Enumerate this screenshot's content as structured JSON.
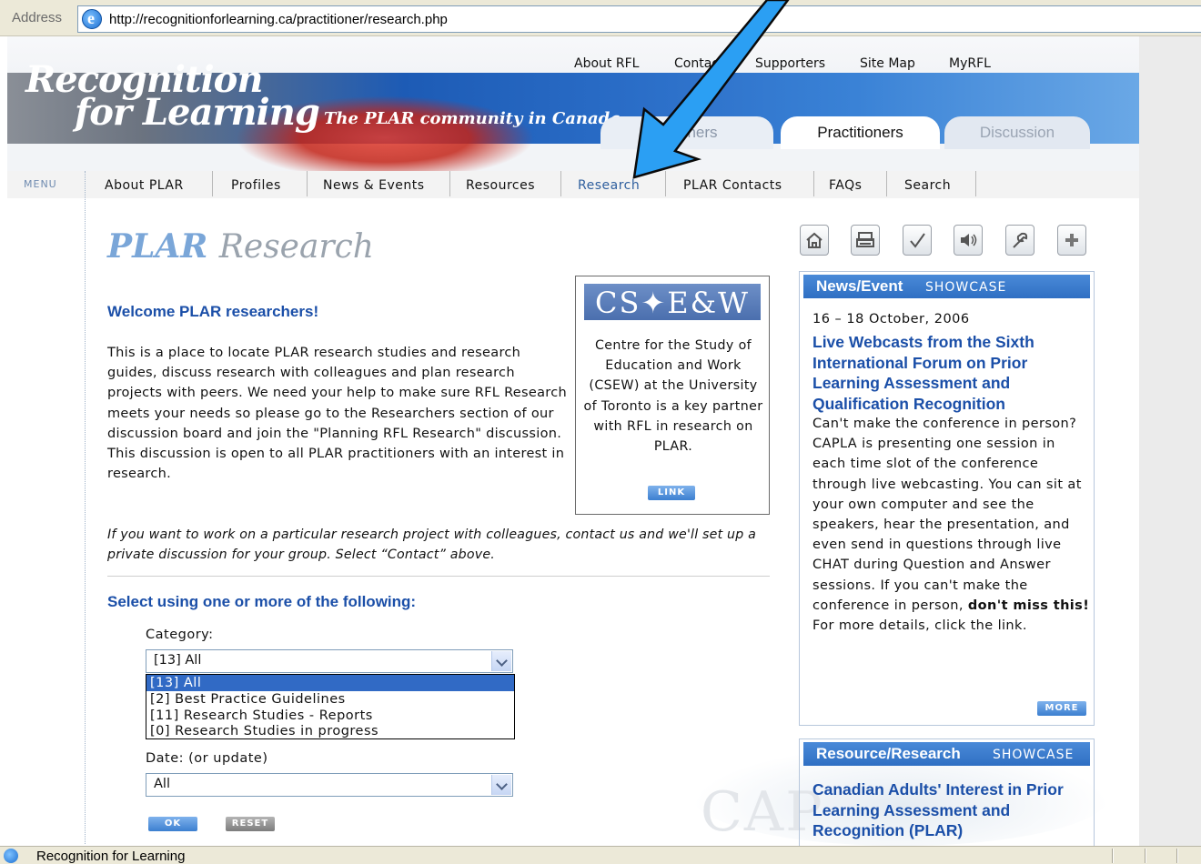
{
  "browser": {
    "address_label": "Address",
    "url": "http://recognitionforlearning.ca/practitioner/research.php",
    "status_text": "Recognition for Learning"
  },
  "site": {
    "logo_line1": "Recognition",
    "logo_line2": "for Learning",
    "tagline": "The PLAR community in Canada",
    "top_nav": [
      "About RFL",
      "Contact",
      "Supporters",
      "Site Map",
      "MyRFL"
    ],
    "tabs": {
      "learners": "Learners",
      "practitioners": "Practitioners",
      "discussion": "Discussion"
    }
  },
  "nav": {
    "menu_label": "MENU",
    "items": [
      "About PLAR",
      "Profiles",
      "News & Events",
      "Resources",
      "Research",
      "PLAR Contacts",
      "FAQs",
      "Search"
    ],
    "active": "Research"
  },
  "main": {
    "title_part1": "PLAR",
    "title_part2": "Research",
    "welcome": "Welcome PLAR researchers!",
    "intro": "This is a place to locate PLAR research studies and research guides, discuss research with colleagues and plan research projects with peers. We need your help to make sure RFL Research meets your needs so please go to the Researchers section of our discussion board and join the \"Planning RFL Research\" discussion. This discussion is open to all PLAR practitioners with an interest in research.",
    "italic_note": "If you want to work on a particular research project with colleagues, contact us and we'll set up a private discussion for your group. Select “Contact” above.",
    "select_heading": "Select using one or more of the following:",
    "category_label": "Category:",
    "category_value": "[13] All",
    "category_options": [
      "[13] All",
      "[2] Best Practice Guidelines",
      "[11] Research Studies - Reports",
      "[0] Research Studies in progress"
    ],
    "date_label": "Date: (or update)",
    "date_value": "All",
    "ok_label": "OK",
    "reset_label": "RESET"
  },
  "csew": {
    "logo_text": "CS✦E&W",
    "text": "Centre for the Study of Education and Work (CSEW) at the University of Toronto is a key partner with RFL in research on PLAR.",
    "link_label": "LINK"
  },
  "tools": [
    "home-icon",
    "print-icon",
    "check-icon",
    "speaker-icon",
    "wrench-icon",
    "plus-icon"
  ],
  "news_showcase": {
    "heading": "News/Event",
    "subheading": "SHOWCASE",
    "date": "16 – 18 October, 2006",
    "headline": "Live Webcasts from the Sixth International Forum on Prior Learning Assessment and Qualification Recognition",
    "body": "Can't make the conference in person? CAPLA is presenting one session in each time slot of the conference through live webcasting. You can sit at your own computer and see the speakers, hear the presentation, and even send in questions through live CHAT during Question and Answer sessions. If you can't make the conference in person,",
    "body_bold": "don't miss this!",
    "body_end": "For more details, click the link.",
    "more_label": "MORE"
  },
  "resource_showcase": {
    "heading": "Resource/Research",
    "subheading": "SHOWCASE",
    "title": "Canadian Adults' Interest in Prior Learning Assessment and Recognition (PLAR)",
    "watermark": "CAP"
  }
}
